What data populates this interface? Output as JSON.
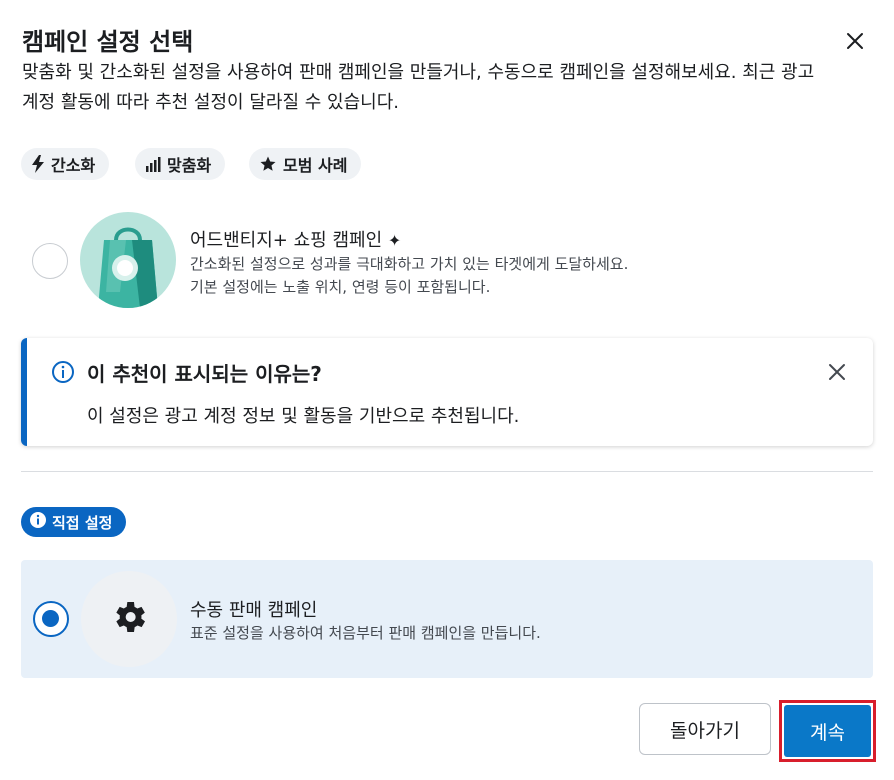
{
  "dialog": {
    "title": "캠페인 설정 선택",
    "subtitle": "맞춤화 및 간소화된 설정을 사용하여 판매 캠페인을 만들거나, 수동으로 캠페인을 설정해보세요. 최근 광고 계정 활동에 따라 추천 설정이 달라질 수 있습니다."
  },
  "chips": [
    {
      "label": "간소화",
      "icon": "lightning-icon"
    },
    {
      "label": "맞춤화",
      "icon": "bar-chart-icon"
    },
    {
      "label": "모범 사례",
      "icon": "star-icon"
    }
  ],
  "advantage_option": {
    "title": "어드밴티지+ 쇼핑 캠페인",
    "sparkle": "✦",
    "desc_line1": "간소화된 설정으로 성과를 극대화하고 가치 있는 타겟에게 도달하세요.",
    "desc_line2": "기본 설정에는 노출 위치, 연령 등이 포함됩니다.",
    "selected": false
  },
  "info_box": {
    "title": "이 추천이 표시되는 이유는?",
    "body": "이 설정은 광고 계정 정보 및 활동을 기반으로 추천됩니다."
  },
  "direct_badge": {
    "label": "직접 설정"
  },
  "manual_option": {
    "title": "수동 판매 캠페인",
    "desc": "표준 설정을 사용하여 처음부터 판매 캠페인을 만듭니다.",
    "selected": true
  },
  "footer": {
    "back_label": "돌아가기",
    "continue_label": "계속"
  },
  "colors": {
    "accent": "#0a66c2",
    "highlight_border": "#d81e2c",
    "selected_card_bg": "#e7f0f9"
  }
}
